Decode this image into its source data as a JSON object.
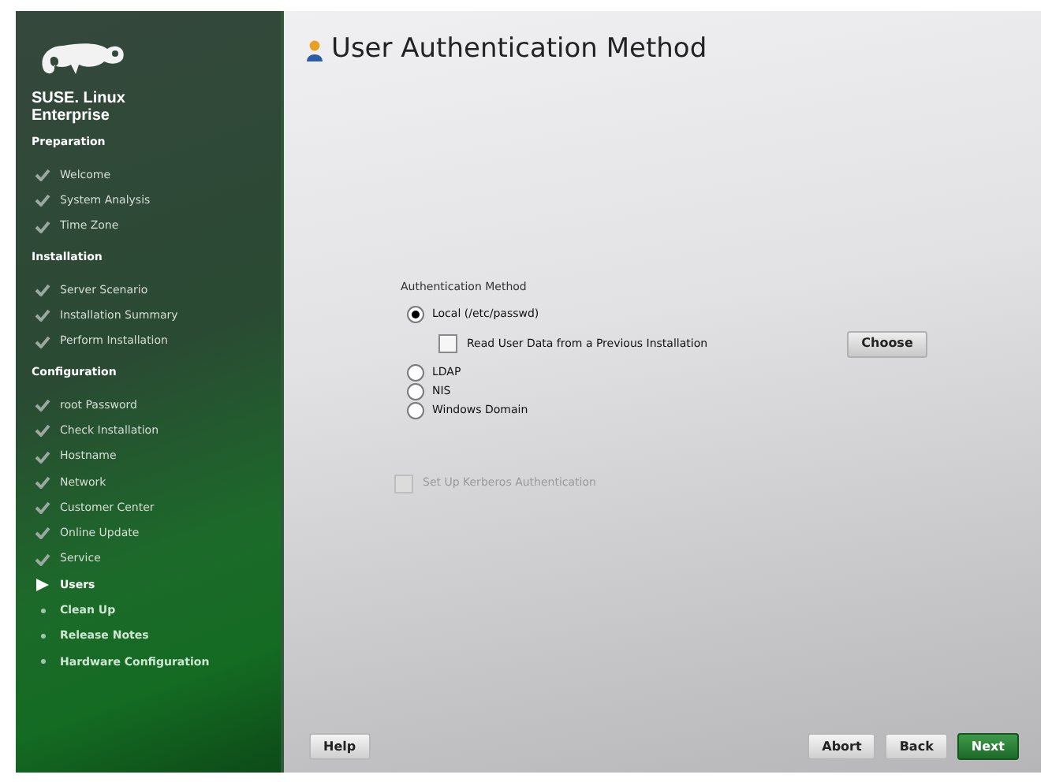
{
  "logo": {
    "lines": [
      "SUSE. Linux",
      "Enterprise"
    ]
  },
  "sections": [
    {
      "heading": "Preparation",
      "steps": [
        {
          "label": "Welcome",
          "kind": "done"
        },
        {
          "label": "System Analysis",
          "kind": "done"
        },
        {
          "label": "Time Zone",
          "kind": "done"
        }
      ]
    },
    {
      "heading": "Installation",
      "steps": [
        {
          "label": "Server Scenario",
          "kind": "done"
        },
        {
          "label": "Installation Summary",
          "kind": "done"
        },
        {
          "label": "Perform Installation",
          "kind": "done"
        }
      ]
    },
    {
      "heading": "Configuration",
      "steps": [
        {
          "label": "root Password",
          "kind": "done"
        },
        {
          "label": "Check Installation",
          "kind": "done"
        },
        {
          "label": "Hostname",
          "kind": "done"
        },
        {
          "label": "Network",
          "kind": "done"
        },
        {
          "label": "Customer Center",
          "kind": "done"
        },
        {
          "label": "Online Update",
          "kind": "done"
        },
        {
          "label": "Service",
          "kind": "done"
        },
        {
          "label": "Users",
          "kind": "current"
        },
        {
          "label": "Clean Up",
          "kind": "pending"
        },
        {
          "label": "Release Notes",
          "kind": "pending"
        },
        {
          "label": "Hardware Configuration",
          "kind": "pending"
        }
      ]
    }
  ],
  "title": "User Authentication Method",
  "group_label": "Authentication Method",
  "options": [
    {
      "label": "Local (/etc/passwd)",
      "selected": true,
      "sub_option": {
        "label": "Read User Data from a Previous Installation",
        "checked": false,
        "button": "Choose"
      }
    },
    {
      "label": "LDAP",
      "selected": false
    },
    {
      "label": "NIS",
      "selected": false
    },
    {
      "label": "Windows Domain",
      "selected": false
    }
  ],
  "kerberos": {
    "label": "Set Up Kerberos Authentication",
    "checked": false,
    "disabled": true
  },
  "left_buttons": [
    {
      "label": "Help",
      "kind": "plain"
    }
  ],
  "right_buttons": [
    {
      "label": "Abort",
      "kind": "plain"
    },
    {
      "label": "Back",
      "kind": "plain"
    },
    {
      "label": "Next",
      "kind": "primary"
    }
  ]
}
